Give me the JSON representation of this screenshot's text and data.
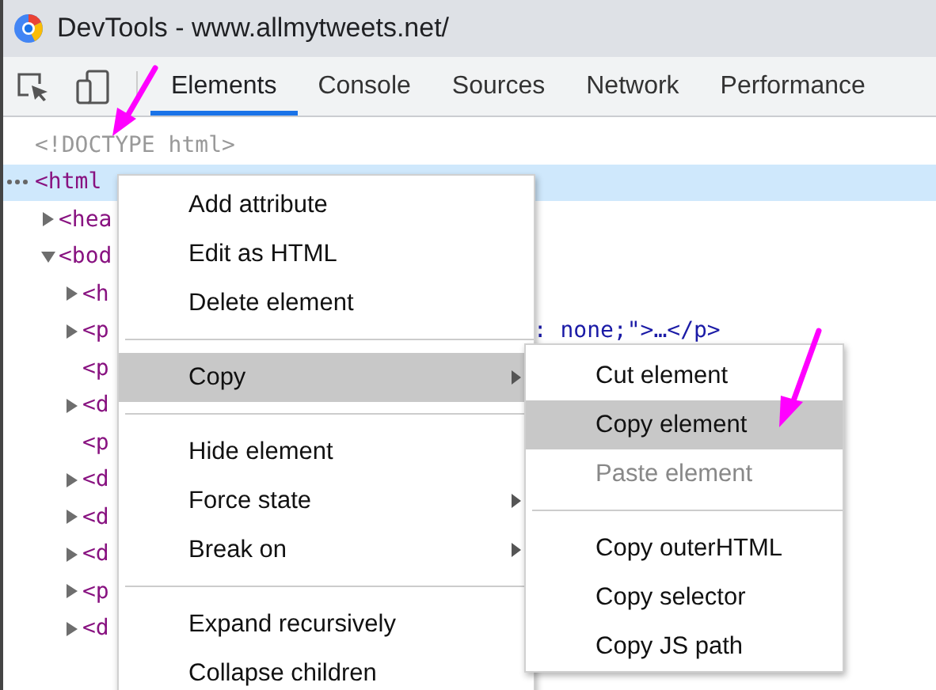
{
  "window": {
    "title": "DevTools - www.allmytweets.net/"
  },
  "tabs": [
    {
      "label": "Elements",
      "selected": true
    },
    {
      "label": "Console",
      "selected": false
    },
    {
      "label": "Sources",
      "selected": false
    },
    {
      "label": "Network",
      "selected": false
    },
    {
      "label": "Performance",
      "selected": false
    }
  ],
  "tree": [
    {
      "text": "<!DOCTYPE html>",
      "kind": "doctype",
      "selected": false
    },
    {
      "text": "<html",
      "kind": "expanded",
      "selected": true,
      "children": [
        {
          "text": "<hea",
          "kind": "collapsed",
          "selected": false
        },
        {
          "text": "<bod",
          "kind": "expanded",
          "selected": false,
          "children": [
            {
              "text": "<h",
              "kind": "collapsed",
              "selected": false
            },
            {
              "text": "<p",
              "kind": "collapsed",
              "selected": false,
              "tail": ": none;\">…</p>"
            },
            {
              "text": "<p",
              "kind": "leaf",
              "selected": false
            },
            {
              "text": "<d",
              "kind": "collapsed",
              "selected": false
            },
            {
              "text": "<p",
              "kind": "leaf",
              "selected": false
            },
            {
              "text": "<d",
              "kind": "collapsed",
              "selected": false
            },
            {
              "text": "<d",
              "kind": "collapsed",
              "selected": false
            },
            {
              "text": "<d",
              "kind": "collapsed",
              "selected": false
            },
            {
              "text": "<p",
              "kind": "collapsed",
              "selected": false
            },
            {
              "text": "<d",
              "kind": "collapsed",
              "selected": false
            }
          ]
        }
      ]
    }
  ],
  "context_menu": [
    {
      "kind": "item",
      "label": "Add attribute",
      "selected": false,
      "submenu": false,
      "disabled": false
    },
    {
      "kind": "item",
      "label": "Edit as HTML",
      "selected": false,
      "submenu": false,
      "disabled": false
    },
    {
      "kind": "item",
      "label": "Delete element",
      "selected": false,
      "submenu": false,
      "disabled": false
    },
    {
      "kind": "separator"
    },
    {
      "kind": "item",
      "label": "Copy",
      "selected": true,
      "submenu": true,
      "disabled": false
    },
    {
      "kind": "separator"
    },
    {
      "kind": "item",
      "label": "Hide element",
      "selected": false,
      "submenu": false,
      "disabled": false
    },
    {
      "kind": "item",
      "label": "Force state",
      "selected": false,
      "submenu": true,
      "disabled": false
    },
    {
      "kind": "item",
      "label": "Break on",
      "selected": false,
      "submenu": true,
      "disabled": false
    },
    {
      "kind": "separator"
    },
    {
      "kind": "item",
      "label": "Expand recursively",
      "selected": false,
      "submenu": false,
      "disabled": false
    },
    {
      "kind": "item",
      "label": "Collapse children",
      "selected": false,
      "submenu": false,
      "disabled": false
    }
  ],
  "copy_submenu": [
    {
      "kind": "item",
      "label": "Cut element",
      "selected": false,
      "submenu": false,
      "disabled": false
    },
    {
      "kind": "item",
      "label": "Copy element",
      "selected": true,
      "submenu": false,
      "disabled": false
    },
    {
      "kind": "item",
      "label": "Paste element",
      "selected": false,
      "submenu": false,
      "disabled": true
    },
    {
      "kind": "separator"
    },
    {
      "kind": "item",
      "label": "Copy outerHTML",
      "selected": false,
      "submenu": false,
      "disabled": false
    },
    {
      "kind": "item",
      "label": "Copy selector",
      "selected": false,
      "submenu": false,
      "disabled": false
    },
    {
      "kind": "item",
      "label": "Copy JS path",
      "selected": false,
      "submenu": false,
      "disabled": false
    }
  ]
}
